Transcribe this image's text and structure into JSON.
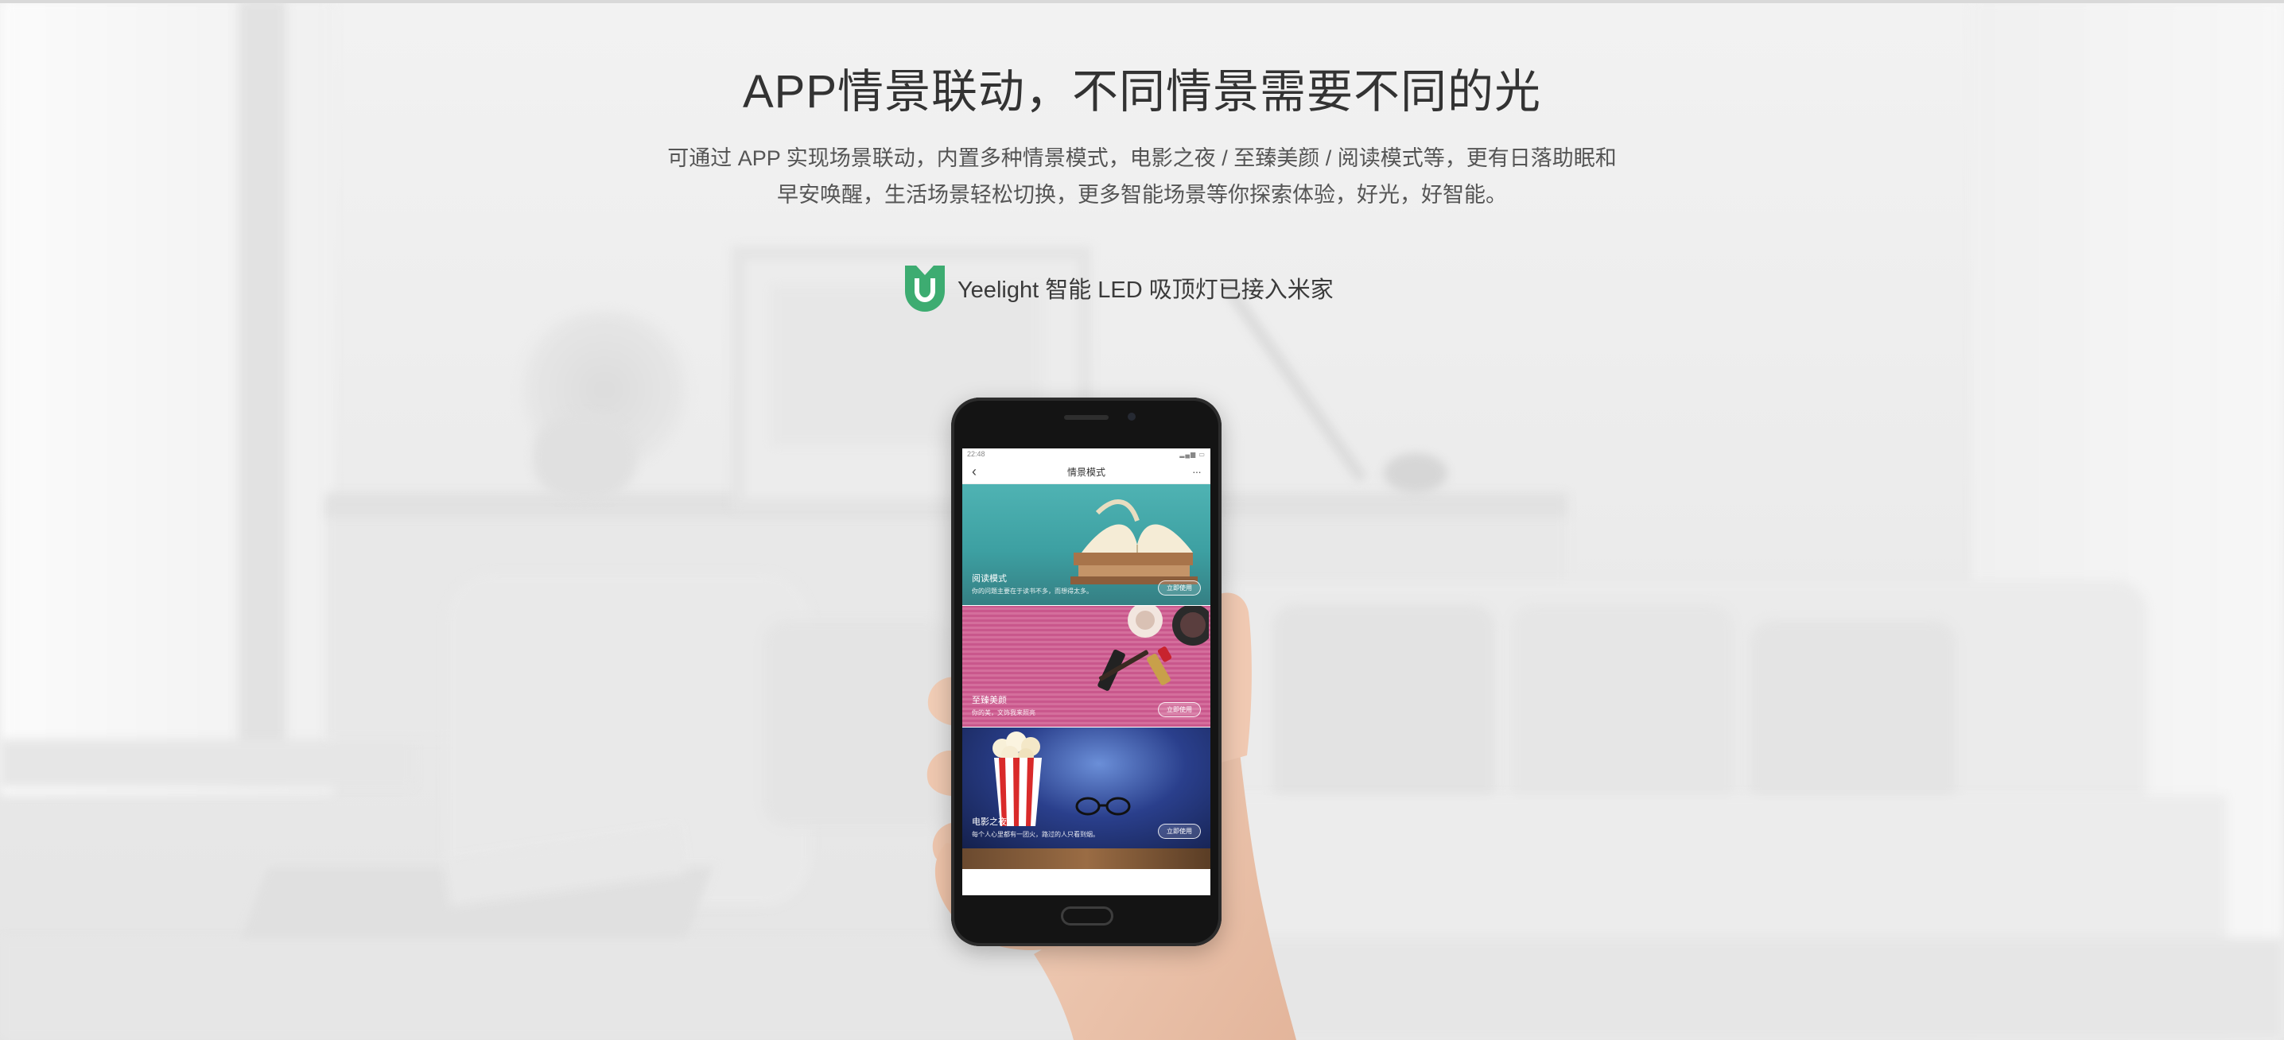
{
  "header": {
    "title": "APP情景联动，不同情景需要不同的光",
    "description_lines": [
      "可通过 APP 实现场景联动，内置多种情景模式，电影之夜 / 至臻美颜 / 阅读模式等，更有日落助眠和",
      "早安唤醒，生活场景轻松切换，更多智能场景等你探索体验，好光，好智能。"
    ],
    "badge_text": "Yeelight 智能 LED 吸顶灯已接入米家",
    "badge_icon": "mijia-logo-icon"
  },
  "phone": {
    "status_time": "22:48",
    "app_title": "情景模式",
    "back_icon": "chevron-left-icon",
    "more_icon": "more-dots-icon",
    "scenes": [
      {
        "label": "阅读模式",
        "subtitle": "你的问题主要在于读书不多，而想得太多。",
        "button": "立即使用"
      },
      {
        "label": "至臻美颜",
        "subtitle": "你的美，文饰我来照亮",
        "button": "立即使用"
      },
      {
        "label": "电影之夜",
        "subtitle": "每个人心里都有一团火，路过的人只看到烟。",
        "button": "立即使用"
      }
    ]
  },
  "colors": {
    "title": "#333333",
    "mijia_green": "#3dac71",
    "reading_card": "#4fb3b3",
    "beauty_card": "#c9578c",
    "movie_card": "#2a3f8c"
  }
}
